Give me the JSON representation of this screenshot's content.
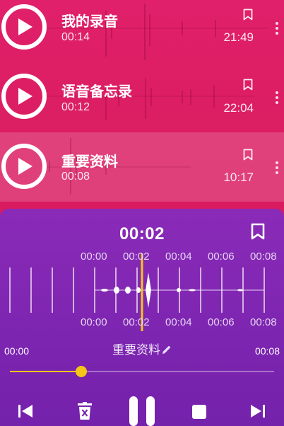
{
  "recordings": [
    {
      "title": "我的录音",
      "duration": "00:14",
      "time": "21:49",
      "selected": false
    },
    {
      "title": "语音备忘录",
      "duration": "00:12",
      "time": "22:04",
      "selected": false
    },
    {
      "title": "重要资料",
      "duration": "00:08",
      "time": "10:17",
      "selected": true
    }
  ],
  "player": {
    "current_time": "00:02",
    "timeline_labels": [
      "00:00",
      "00:02",
      "00:04",
      "00:06",
      "00:08"
    ],
    "start_time": "00:00",
    "end_time": "00:08",
    "file_name": "重要资料",
    "progress_fraction": 0.27
  },
  "icons": {
    "play": "play-icon",
    "bookmark": "bookmark-icon",
    "more": "more-vert-icon",
    "edit": "pencil-icon",
    "previous": "skip-previous-icon",
    "delete": "delete-icon",
    "pause": "pause-icon",
    "stop": "stop-icon",
    "next": "skip-next-icon"
  },
  "colors": {
    "list_background": "#dc1e63",
    "player_background": "#7c25b0",
    "accent": "#f5c518"
  }
}
